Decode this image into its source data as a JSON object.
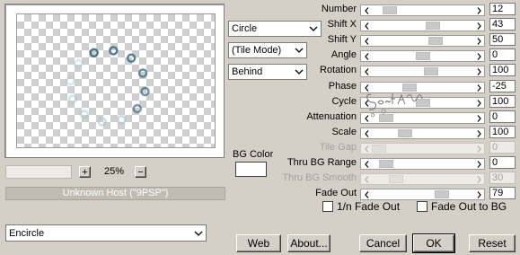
{
  "preview": {
    "zoom_value": "25%",
    "zoom_plus": "+",
    "zoom_minus": "−",
    "status_text": "Unknown Host (\"9PSP\")"
  },
  "combos": {
    "shape": "Circle",
    "tile_mode": "(Tile Mode)",
    "order": "Behind",
    "filter": "Encircle"
  },
  "bg_color": {
    "label": "BG Color",
    "value": "#ffffff"
  },
  "params": [
    {
      "label": "Number",
      "value": "12",
      "position": 0.12,
      "enabled": true
    },
    {
      "label": "Shift X",
      "value": "43",
      "position": 0.62,
      "enabled": true
    },
    {
      "label": "Shift Y",
      "value": "50",
      "position": 0.65,
      "enabled": true
    },
    {
      "label": "Angle",
      "value": "0",
      "position": 0.5,
      "enabled": true
    },
    {
      "label": "Rotation",
      "value": "100",
      "position": 0.6,
      "enabled": true
    },
    {
      "label": "Phase",
      "value": "-25",
      "position": 0.35,
      "enabled": true
    },
    {
      "label": "Cycle",
      "value": "100",
      "position": 0.5,
      "enabled": true
    },
    {
      "label": "Attenuation",
      "value": "0",
      "position": 0.08,
      "enabled": true
    },
    {
      "label": "Scale",
      "value": "100",
      "position": 0.3,
      "enabled": true
    },
    {
      "label": "Tile Gap",
      "value": "0",
      "position": 0.0,
      "enabled": false
    },
    {
      "label": "Thru BG Range",
      "value": "0",
      "position": 0.08,
      "enabled": true
    },
    {
      "label": "Thru BG Smooth",
      "value": "30",
      "position": 0.2,
      "enabled": false
    },
    {
      "label": "Fade Out",
      "value": "79",
      "position": 0.72,
      "enabled": true
    }
  ],
  "checkboxes": {
    "fade_1n": {
      "label": "1/n Fade Out",
      "checked": false
    },
    "fade_bg": {
      "label": "Fade Out to BG",
      "checked": false
    }
  },
  "buttons": {
    "web": "Web",
    "about": "About...",
    "cancel": "Cancel",
    "ok": "OK",
    "reset": "Reset"
  },
  "colors": {
    "dialog_bg": "#d4d0c8",
    "ring_dark": "#3d6f86",
    "ring_light": "#a9c6d3"
  }
}
